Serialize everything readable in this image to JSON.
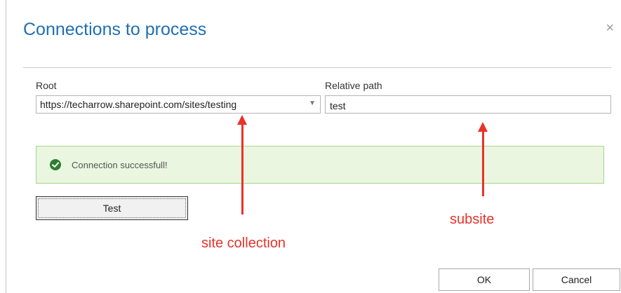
{
  "dialog": {
    "title": "Connections to process",
    "close_glyph": "×"
  },
  "form": {
    "root_label": "Root",
    "root_value": "https://techarrow.sharepoint.com/sites/testing",
    "relative_label": "Relative path",
    "relative_value": "test"
  },
  "status": {
    "message": "Connection successfull!",
    "color": "#2e7d32"
  },
  "buttons": {
    "test": "Test",
    "ok": "OK",
    "cancel": "Cancel"
  },
  "annotations": {
    "site_collection": "site collection",
    "subsite": "subsite",
    "color": "#e8322a"
  }
}
